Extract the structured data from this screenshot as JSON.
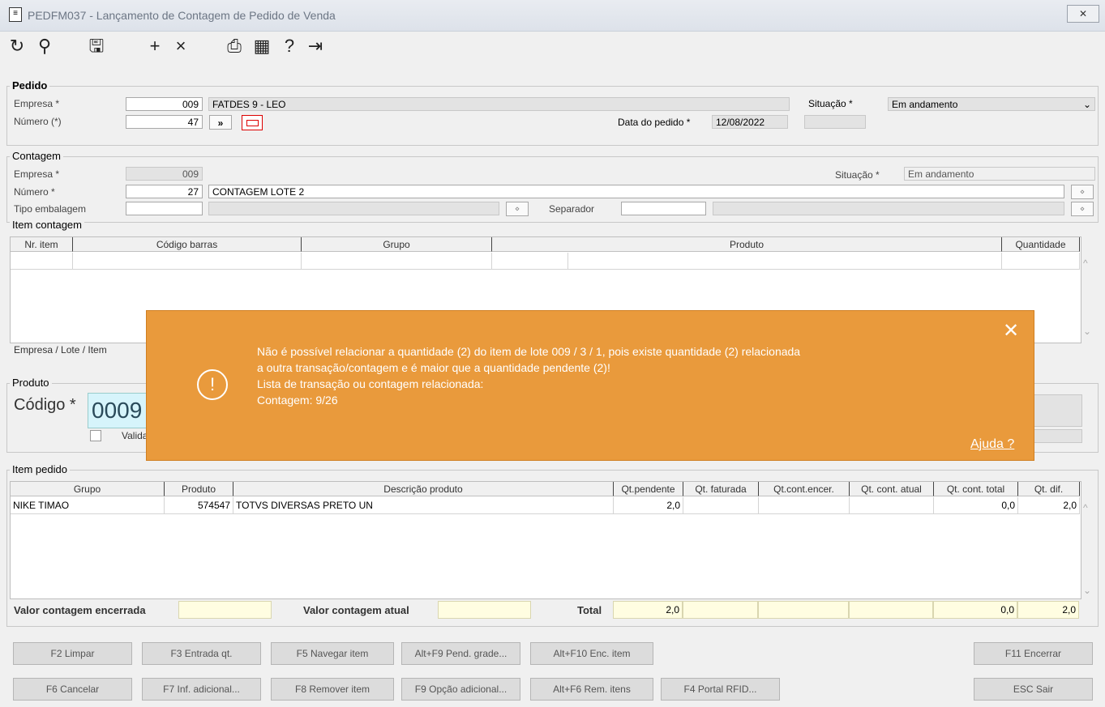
{
  "window": {
    "title": "PEDFM037 - Lançamento de Contagem de Pedido de Venda",
    "close_icon": "close-icon"
  },
  "toolbar": {
    "icons": [
      "refresh-icon",
      "search-icon",
      "save-icon",
      "add-icon",
      "delete-icon",
      "print-icon",
      "calendar-icon",
      "help-icon",
      "exit-icon"
    ]
  },
  "pedido": {
    "legend": "Pedido",
    "empresa_label": "Empresa *",
    "empresa_value": "009",
    "empresa_desc": "FATDES 9 - LEO",
    "numero_label": "Número (*)",
    "numero_value": "47",
    "nav_label": "»",
    "data_label": "Data do pedido *",
    "data_value": "12/08/2022",
    "situacao_label": "Situação *",
    "situacao_value": "Em andamento"
  },
  "contagem": {
    "legend": "Contagem",
    "empresa_label": "Empresa *",
    "empresa_value": "009",
    "situacao_label": "Situação *",
    "situacao_value": "Em andamento",
    "numero_label": "Número *",
    "numero_value": "27",
    "numero_desc": "CONTAGEM LOTE 2",
    "tipo_label": "Tipo embalagem",
    "separador_label": "Separador"
  },
  "item_contagem": {
    "legend": "Item contagem",
    "columns": [
      "Nr. item",
      "Código barras",
      "Grupo",
      "Produto",
      "Quantidade"
    ],
    "footer_label": "Empresa / Lote / Item"
  },
  "produto": {
    "legend": "Produto",
    "codigo_label": "Código *",
    "codigo_value": "0009",
    "valida_label": "Valida"
  },
  "item_pedido": {
    "legend": "Item pedido",
    "columns": [
      "Grupo",
      "Produto",
      "Descrição produto",
      "Qt.pendente",
      "Qt. faturada",
      "Qt.cont.encer.",
      "Qt. cont. atual",
      "Qt. cont. total",
      "Qt. dif."
    ],
    "rows": [
      {
        "grupo": "NIKE TIMAO",
        "produto": "574547",
        "descricao": "TOTVS DIVERSAS PRETO UN",
        "qt_pendente": "2,0",
        "qt_faturada": "",
        "qt_cont_encer": "",
        "qt_cont_atual": "",
        "qt_cont_total": "0,0",
        "qt_dif": "2,0"
      }
    ],
    "valor_encerrada_label": "Valor contagem encerrada",
    "valor_atual_label": "Valor contagem atual",
    "total_label": "Total",
    "totals": {
      "qt_pendente": "2,0",
      "qt_cont_total": "0,0",
      "qt_dif": "2,0"
    }
  },
  "buttons": {
    "f2": "F2 Limpar",
    "f3": "F3 Entrada qt.",
    "f5": "F5 Navegar item",
    "altf9": "Alt+F9 Pend. grade...",
    "altf10": "Alt+F10 Enc. item",
    "f11": "F11 Encerrar",
    "f6": "F6 Cancelar",
    "f7": "F7 Inf. adicional...",
    "f8": "F8 Remover item",
    "f9": "F9 Opção adicional...",
    "altf6": "Alt+F6 Rem. itens",
    "f4": "F4 Portal RFID...",
    "esc": "ESC Sair"
  },
  "toast": {
    "lines": [
      "Não é possível relacionar a quantidade (2) do item de lote 009 / 3 / 1, pois existe quantidade (2) relacionada",
      "a outra transação/contagem e é maior que a quantidade pendente (2)!",
      "Lista de transação ou contagem relacionada:",
      "Contagem: 9/26"
    ],
    "help_label": "Ajuda ?",
    "bg_color": "#e99a3c"
  }
}
